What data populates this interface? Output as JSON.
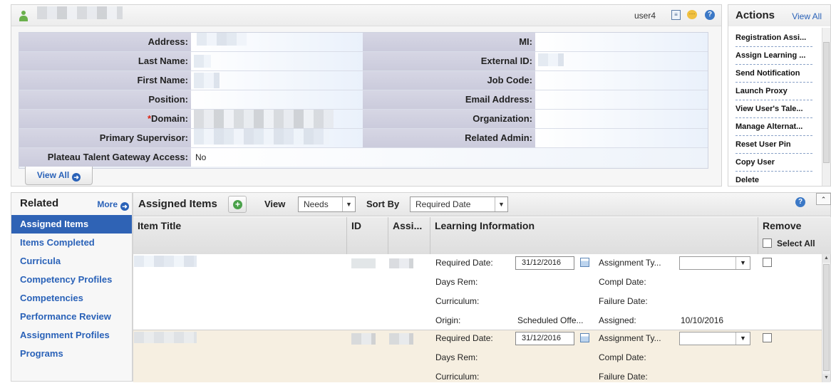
{
  "profile": {
    "username": "user4",
    "fields_left": [
      {
        "label": "Address:",
        "value": ""
      },
      {
        "label": "Last Name:",
        "value": ""
      },
      {
        "label": "First Name:",
        "value": ""
      },
      {
        "label": "Position:",
        "value": ""
      },
      {
        "label": "Domain:",
        "value": "",
        "required": "*"
      },
      {
        "label": "Primary Supervisor:",
        "value": ""
      },
      {
        "label": "Plateau Talent Gateway Access:",
        "value": "No"
      }
    ],
    "fields_right": [
      {
        "label": "MI:",
        "value": ""
      },
      {
        "label": "External ID:",
        "value": ""
      },
      {
        "label": "Job Code:",
        "value": ""
      },
      {
        "label": "Email Address:",
        "value": ""
      },
      {
        "label": "Organization:",
        "value": ""
      },
      {
        "label": "Related Admin:",
        "value": ""
      }
    ],
    "view_all": "View All"
  },
  "actions": {
    "title": "Actions",
    "view_all": "View All",
    "items": [
      "Registration Assi...",
      "Assign Learning ...",
      "Send Notification",
      "Launch Proxy",
      "View User's Tale...",
      "Manage Alternat...",
      "Reset User Pin",
      "Copy User",
      "Delete"
    ]
  },
  "related": {
    "title": "Related",
    "more": "More",
    "items": [
      "Assigned Items",
      "Items Completed",
      "Curricula",
      "Competency Profiles",
      "Competencies",
      "Performance Review",
      "Assignment Profiles",
      "Programs"
    ]
  },
  "assigned": {
    "title": "Assigned Items",
    "view_label": "View",
    "view_value": "Needs",
    "sort_label": "Sort By",
    "sort_value": "Required Date",
    "columns": {
      "item_title": "Item Title",
      "id": "ID",
      "assi": "Assi...",
      "learning": "Learning Information",
      "remove": "Remove",
      "select_all": "Select All"
    },
    "rows": [
      {
        "required_date_label": "Required Date:",
        "required_date": "31/12/2016",
        "assignment_type_label": "Assignment Ty...",
        "days_rem_label": "Days Rem:",
        "compl_date_label": "Compl Date:",
        "curriculum_label": "Curriculum:",
        "failure_date_label": "Failure Date:",
        "origin_label": "Origin:",
        "origin_value": "Scheduled Offe...",
        "assigned_label": "Assigned:",
        "assigned_value": "10/10/2016"
      },
      {
        "required_date_label": "Required Date:",
        "required_date": "31/12/2016",
        "assignment_type_label": "Assignment Ty...",
        "days_rem_label": "Days Rem:",
        "compl_date_label": "Compl Date:",
        "curriculum_label": "Curriculum:",
        "failure_date_label": "Failure Date:"
      }
    ]
  },
  "icons": [
    "user-icon",
    "notes-icon",
    "chat-icon",
    "help-icon",
    "arrow-circle-right-icon",
    "add-icon",
    "calendar-icon",
    "dropdown-arrow-icon",
    "collapse-icon"
  ]
}
